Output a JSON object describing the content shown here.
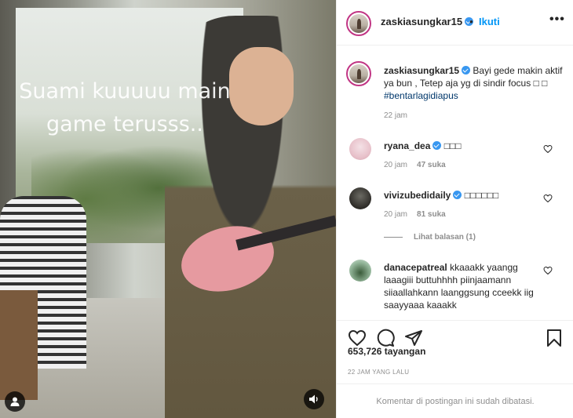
{
  "media": {
    "overlay_lines": [
      "Suami kuuuuu main",
      "game terusss.."
    ]
  },
  "header": {
    "username": "zaskiasungkar15",
    "separator": "•",
    "follow_label": "Ikuti",
    "more_label": "•••"
  },
  "caption": {
    "username": "zaskiasungkar15",
    "text": "Bayi gede makin aktif ya bun , Tetep aja yg di sindir focus",
    "emoji": " □ □ ",
    "hashtag": "#bentarlagidiapus",
    "time": "22 jam"
  },
  "comments": [
    {
      "username": "ryana_dea",
      "verified": true,
      "text": "□□□",
      "time": "20 jam",
      "likes": "47 suka"
    },
    {
      "username": "vivizubedidaily",
      "verified": true,
      "text": "□□□□□□",
      "time": "20 jam",
      "likes": "81 suka"
    },
    {
      "username": "danacepatreal",
      "verified": false,
      "text": "kkaaakk yaangg laaagiii buttuhhhh piinjaamann siiaallahkann laanggsung cceekk iig saayyaaa kaaakk"
    }
  ],
  "view_replies": "Lihat balasan (1)",
  "stats": {
    "views": "653,726 tayangan",
    "posted": "22 JAM YANG LALU"
  },
  "footer": {
    "comments_limited": "Komentar di postingan ini sudah dibatasi."
  },
  "colors": {
    "accent": "#0095f6",
    "verified": "#3897f0",
    "text": "#262626",
    "muted": "#8e8e8e",
    "hashtag": "#00376b"
  }
}
